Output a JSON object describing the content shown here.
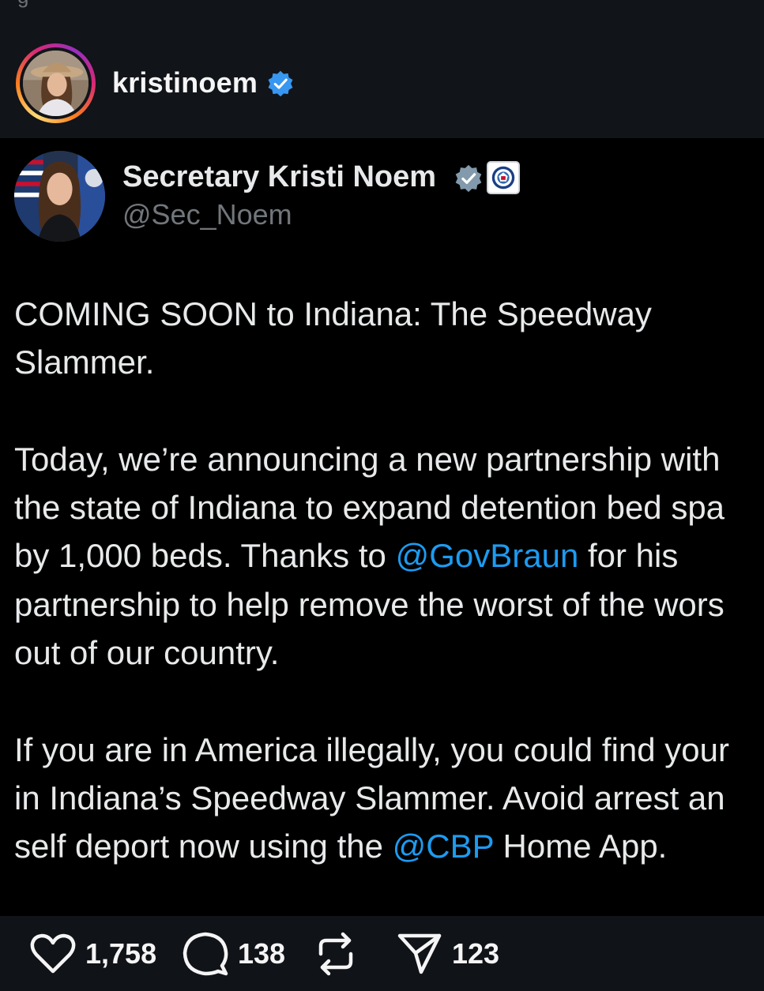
{
  "post": {
    "cut_text": "g",
    "username": "kristinoem",
    "verified_icon": "verified-badge-icon",
    "avatar": "profile-avatar"
  },
  "tweet": {
    "display_name": "Secretary Kristi Noem",
    "handle": "@Sec_Noem",
    "verified_icon": "gray-checkmark-icon",
    "affiliation_icon": "dhs-seal-icon",
    "paragraphs": [
      [
        {
          "text": "COMING SOON to Indiana: The Speedway"
        }
      ],
      [
        {
          "text": "Slammer."
        }
      ],
      [],
      [
        {
          "text": "Today, we’re announcing a new partnership with"
        }
      ],
      [
        {
          "text": "the state of Indiana to expand detention bed spa"
        }
      ],
      [
        {
          "text": "by 1,000 beds. Thanks to "
        },
        {
          "text": "@GovBraun",
          "mention": true
        },
        {
          "text": " for his"
        }
      ],
      [
        {
          "text": "partnership to help remove the worst of the wors"
        }
      ],
      [
        {
          "text": "out of our country."
        }
      ],
      [],
      [
        {
          "text": "If you are in America illegally, you could find your"
        }
      ],
      [
        {
          "text": "in Indiana’s Speedway Slammer. Avoid arrest an"
        }
      ],
      [
        {
          "text": "self deport now using the "
        },
        {
          "text": "@CBP",
          "mention": true
        },
        {
          "text": " Home App."
        }
      ]
    ]
  },
  "actions": {
    "likes": "1,758",
    "comments": "138",
    "shares": "123"
  },
  "colors": {
    "background": "#101318",
    "tweet_background": "#000000",
    "text": "#e7e9ea",
    "handle": "#71767b",
    "mention": "#1d9bf0",
    "ig_verified": "#3897f0"
  }
}
